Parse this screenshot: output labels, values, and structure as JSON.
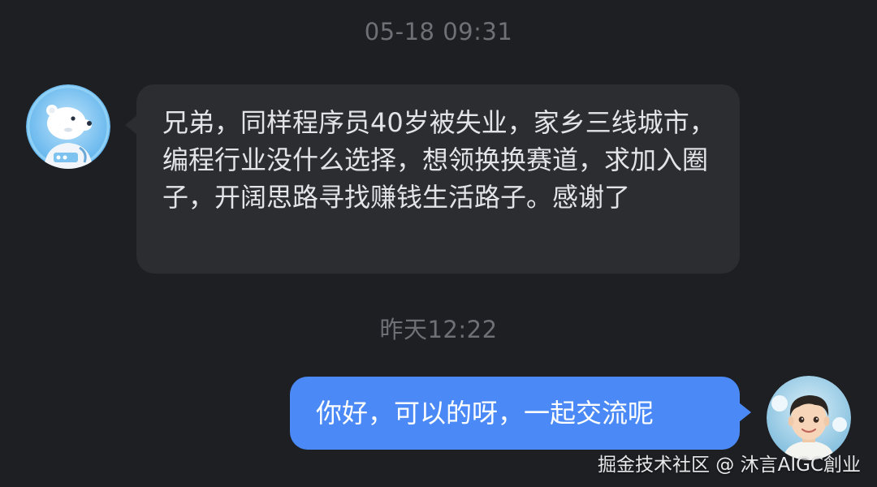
{
  "conversation": {
    "timestamps": [
      "05-18 09:31",
      "昨天12:22"
    ],
    "messages": [
      {
        "direction": "incoming",
        "avatar": "cartoon-polar-bear-astronaut-avatar",
        "text": "兄弟，同样程序员40岁被失业，家乡三线城市，编程行业没什么选择，想领换换赛道，求加入圈子，开阔思路寻找赚钱生活路子。感谢了"
      },
      {
        "direction": "outgoing",
        "avatar": "cartoon-boy-avatar",
        "text": "你好，可以的呀，一起交流呢"
      }
    ]
  },
  "watermark": "掘金技术社区 @ 沐言AIGC創业",
  "colors": {
    "background": "#1e1f23",
    "incoming_bubble": "#2c2d31",
    "outgoing_bubble": "#4b8af6",
    "timestamp_text": "#6f7076"
  }
}
